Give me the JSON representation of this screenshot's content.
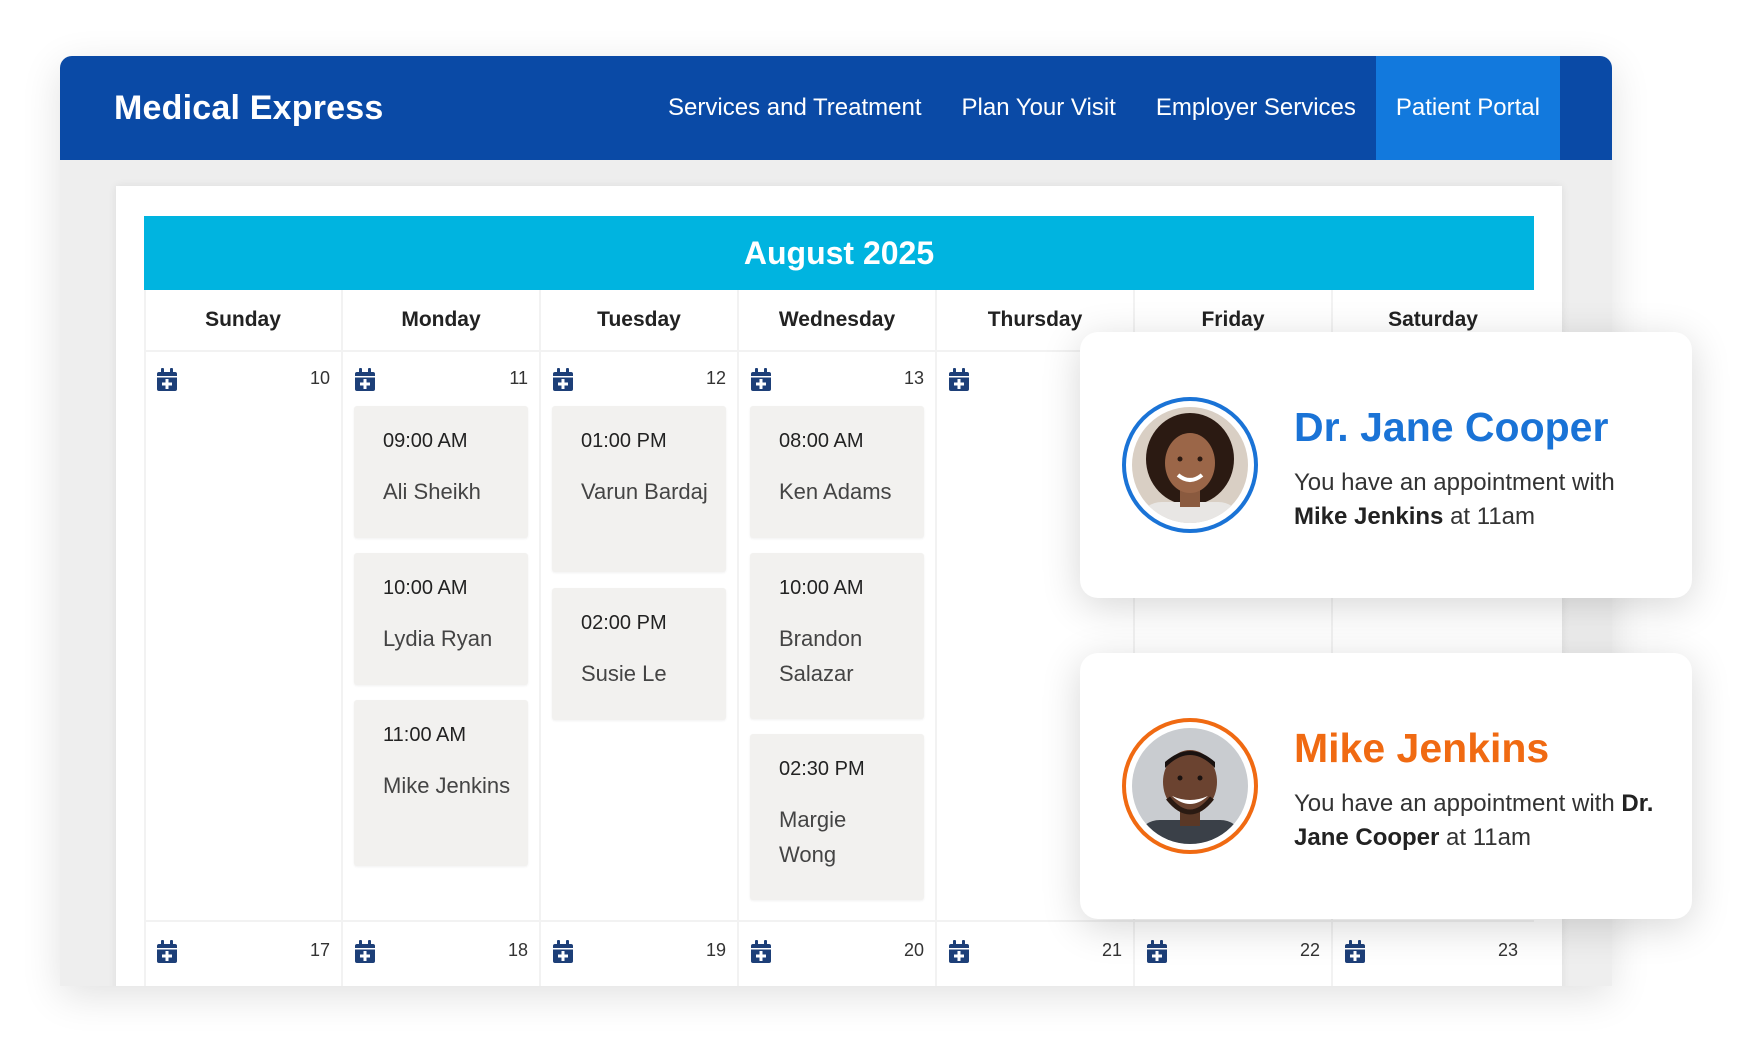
{
  "app": {
    "brand": "Medical Express",
    "nav": [
      {
        "label": "Services and Treatment",
        "active": false
      },
      {
        "label": "Plan Your Visit",
        "active": false
      },
      {
        "label": "Employer Services",
        "active": false
      },
      {
        "label": "Patient Portal",
        "active": true
      }
    ]
  },
  "calendar": {
    "month_title": "August 2025",
    "weekdays": [
      "Sunday",
      "Monday",
      "Tuesday",
      "Wednesday",
      "Thursday",
      "Friday",
      "Saturday"
    ],
    "week1_dates": [
      "10",
      "11",
      "12",
      "13"
    ],
    "week2_dates": [
      "17",
      "18",
      "19",
      "20",
      "21",
      "22",
      "23"
    ],
    "appointments": {
      "monday": [
        {
          "time": "09:00 AM",
          "name": "Ali Sheikh"
        },
        {
          "time": "10:00 AM",
          "name": "Lydia Ryan"
        },
        {
          "time": "11:00 AM",
          "name": "Mike Jenkins"
        }
      ],
      "tuesday": [
        {
          "time": "01:00 PM",
          "name": "Varun Bardaj"
        },
        {
          "time": "02:00 PM",
          "name": "Susie Le"
        }
      ],
      "wednesday": [
        {
          "time": "08:00 AM",
          "name": "Ken Adams"
        },
        {
          "time": "10:00 AM",
          "name": "Brandon Salazar"
        },
        {
          "time": "02:30 PM",
          "name": "Margie Wong"
        }
      ]
    },
    "icon": "calendar-plus-icon"
  },
  "cards": [
    {
      "name": "Dr. Jane Cooper",
      "msg_pre": "You have an appointment with ",
      "msg_bold": "Mike Jenkins",
      "msg_post": " at 11am",
      "color": "#1a73d6"
    },
    {
      "name": "Mike Jenkins",
      "msg_pre": "You have an appointment with ",
      "msg_bold": "Dr. Jane Cooper",
      "msg_post": " at 11am",
      "color": "#f06a12"
    }
  ],
  "colors": {
    "navbar": "#0a4aa6",
    "nav_active": "#1279dd",
    "month_bar": "#00b4e0",
    "icon": "#1d3f78"
  }
}
